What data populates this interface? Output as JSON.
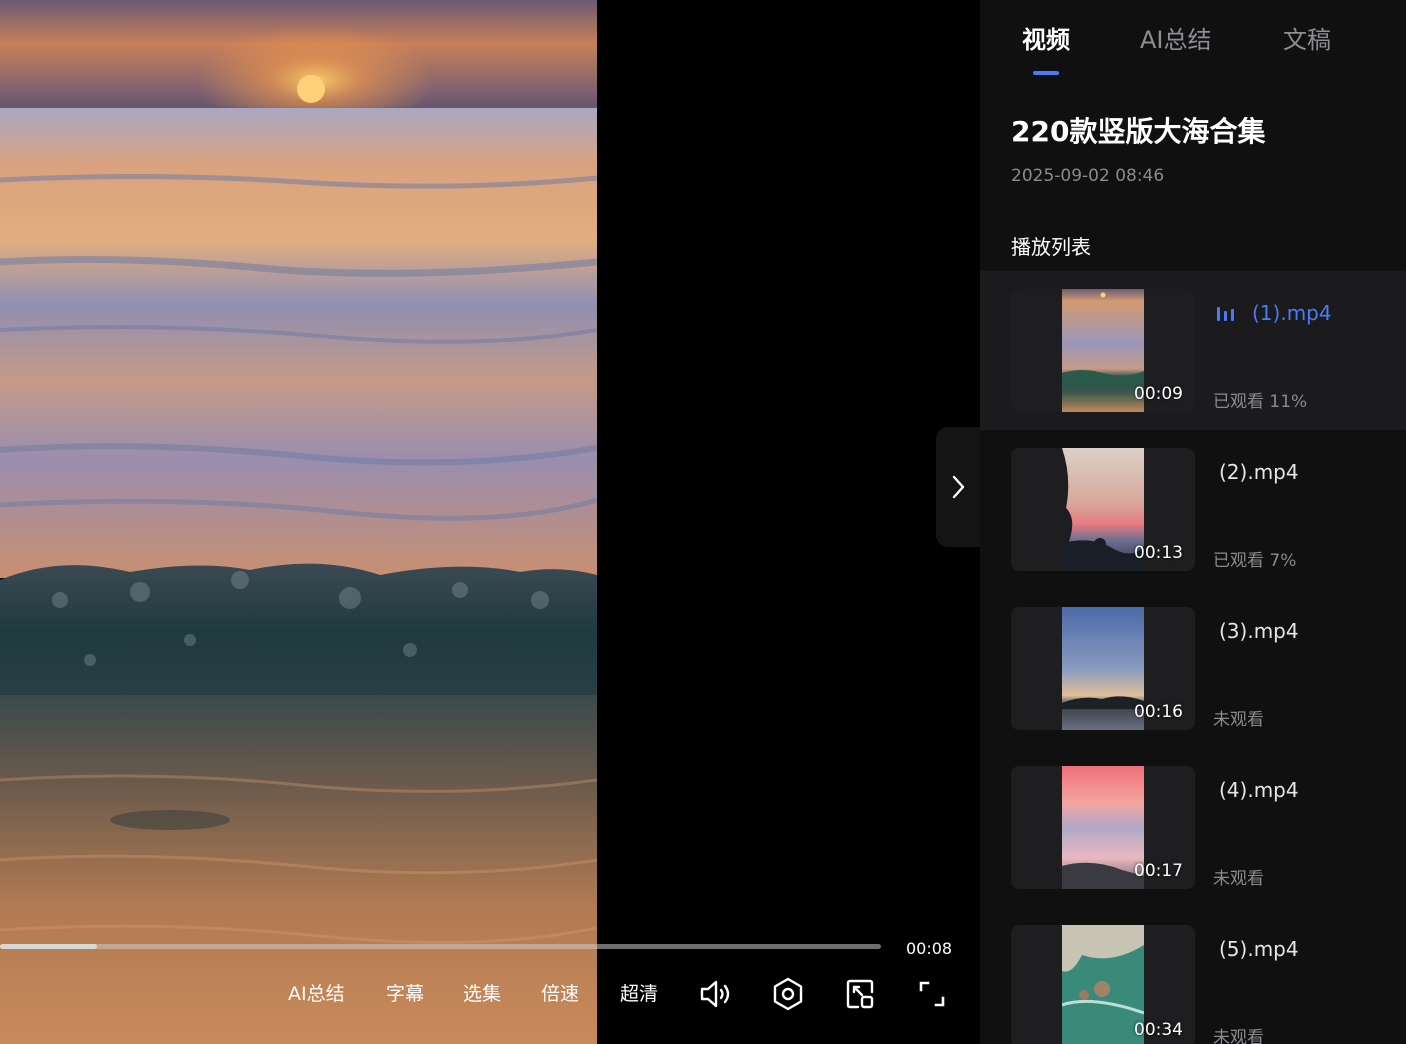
{
  "player": {
    "progress": 0.11,
    "time": "00:08",
    "controls": {
      "ai_summary": "AI总结",
      "subtitles": "字幕",
      "episodes": "选集",
      "speed": "倍速",
      "quality": "超清"
    },
    "icons": [
      "volume-icon",
      "settings-icon",
      "picture-in-picture-icon",
      "fullscreen-icon"
    ]
  },
  "panel": {
    "tabs": [
      {
        "label": "视频",
        "active": true
      },
      {
        "label": "AI总结",
        "active": false
      },
      {
        "label": "文稿",
        "active": false
      }
    ],
    "title": "220款竖版大海合集",
    "date": "2025-09-02 08:46",
    "playlist_heading": "播放列表",
    "playlist": [
      {
        "name": "(1).mp4",
        "duration": "00:09",
        "status": "已观看 11%",
        "current": true
      },
      {
        "name": "(2).mp4",
        "duration": "00:13",
        "status": "已观看 7%",
        "current": false
      },
      {
        "name": "(3).mp4",
        "duration": "00:16",
        "status": "未观看",
        "current": false
      },
      {
        "name": "(4).mp4",
        "duration": "00:17",
        "status": "未观看",
        "current": false
      },
      {
        "name": "(5).mp4",
        "duration": "00:34",
        "status": "未观看",
        "current": false
      }
    ]
  },
  "colors": {
    "accent": "#4a7bf7",
    "panel_bg": "#101011",
    "current_item_bg": "#1b1b1e"
  }
}
